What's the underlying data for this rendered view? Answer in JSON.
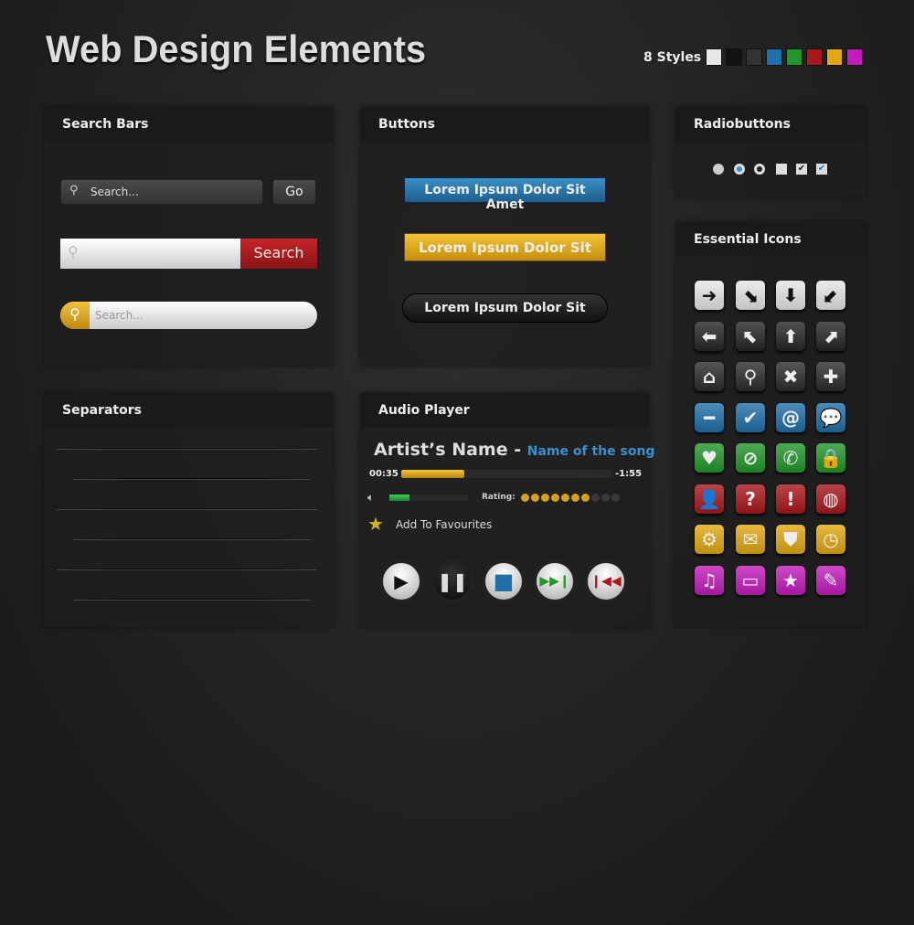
{
  "title": "Web Design Elements",
  "styles": {
    "label": "8 Styles",
    "colors": [
      "#e8e8e8",
      "#111111",
      "#333333",
      "#1f6fa8",
      "#22962a",
      "#a8171c",
      "#e0a812",
      "#c21cba"
    ]
  },
  "search_bars": {
    "title": "Search Bars",
    "placeholder1": "Search...",
    "go": "Go",
    "search_button": "Search",
    "placeholder3": "Search..."
  },
  "buttons": {
    "title": "Buttons",
    "blue": "Lorem Ipsum Dolor Sit Amet",
    "yellow": "Lorem Ipsum Dolor Sit",
    "dark": "Lorem Ipsum Dolor Sit"
  },
  "radiobuttons": {
    "title": "Radiobuttons"
  },
  "icons": {
    "title": "Essential Icons",
    "rows": [
      {
        "color": "#e6e6e6",
        "fg": "#111",
        "items": [
          [
            "arrow-right",
            "➜"
          ],
          [
            "arrow-down-right",
            "⬊"
          ],
          [
            "arrow-down",
            "⬇"
          ],
          [
            "arrow-down-left",
            "⬋"
          ]
        ]
      },
      {
        "color": "#262626",
        "fg": "#eee",
        "items": [
          [
            "arrow-left",
            "⬅"
          ],
          [
            "arrow-up-left",
            "⬉"
          ],
          [
            "arrow-up",
            "⬆"
          ],
          [
            "arrow-up-right",
            "⬈"
          ]
        ]
      },
      {
        "color": "#2c2c2c",
        "fg": "#eee",
        "items": [
          [
            "home",
            "⌂"
          ],
          [
            "search",
            "⚲"
          ],
          [
            "close",
            "✖"
          ],
          [
            "plus",
            "✚"
          ]
        ]
      },
      {
        "color": "#1f6fa8",
        "fg": "#eee",
        "items": [
          [
            "minus",
            "━"
          ],
          [
            "check",
            "✔"
          ],
          [
            "at",
            "@"
          ],
          [
            "chat",
            "💬"
          ]
        ]
      },
      {
        "color": "#22962a",
        "fg": "#eee",
        "items": [
          [
            "heart",
            "♥"
          ],
          [
            "block",
            "⊘"
          ],
          [
            "phone",
            "✆"
          ],
          [
            "lock",
            "🔒"
          ]
        ]
      },
      {
        "color": "#a8171c",
        "fg": "#eee",
        "items": [
          [
            "user",
            "👤"
          ],
          [
            "question",
            "?"
          ],
          [
            "exclamation",
            "!"
          ],
          [
            "globe",
            "◍"
          ]
        ]
      },
      {
        "color": "#e0a812",
        "fg": "#eee",
        "items": [
          [
            "gear",
            "⚙"
          ],
          [
            "mail",
            "✉"
          ],
          [
            "shield",
            "⛊"
          ],
          [
            "clock",
            "◷"
          ]
        ]
      },
      {
        "color": "#c21cba",
        "fg": "#eee",
        "items": [
          [
            "music",
            "♫"
          ],
          [
            "tv",
            "▭"
          ],
          [
            "star",
            "★"
          ],
          [
            "pencil",
            "✎"
          ]
        ]
      }
    ]
  },
  "separators": {
    "title": "Separators"
  },
  "audio": {
    "title": "Audio Player",
    "artist": "Artist’s Name",
    "dash": "-",
    "song": "Name of the song",
    "elapsed": "00:35",
    "remaining": "-1:55",
    "progress": 0.3,
    "volume": 0.25,
    "rating_label": "Rating:",
    "rating": 7,
    "rating_max": 10,
    "favourite": "Add To Favourites",
    "accent": "#3b8fd0"
  }
}
